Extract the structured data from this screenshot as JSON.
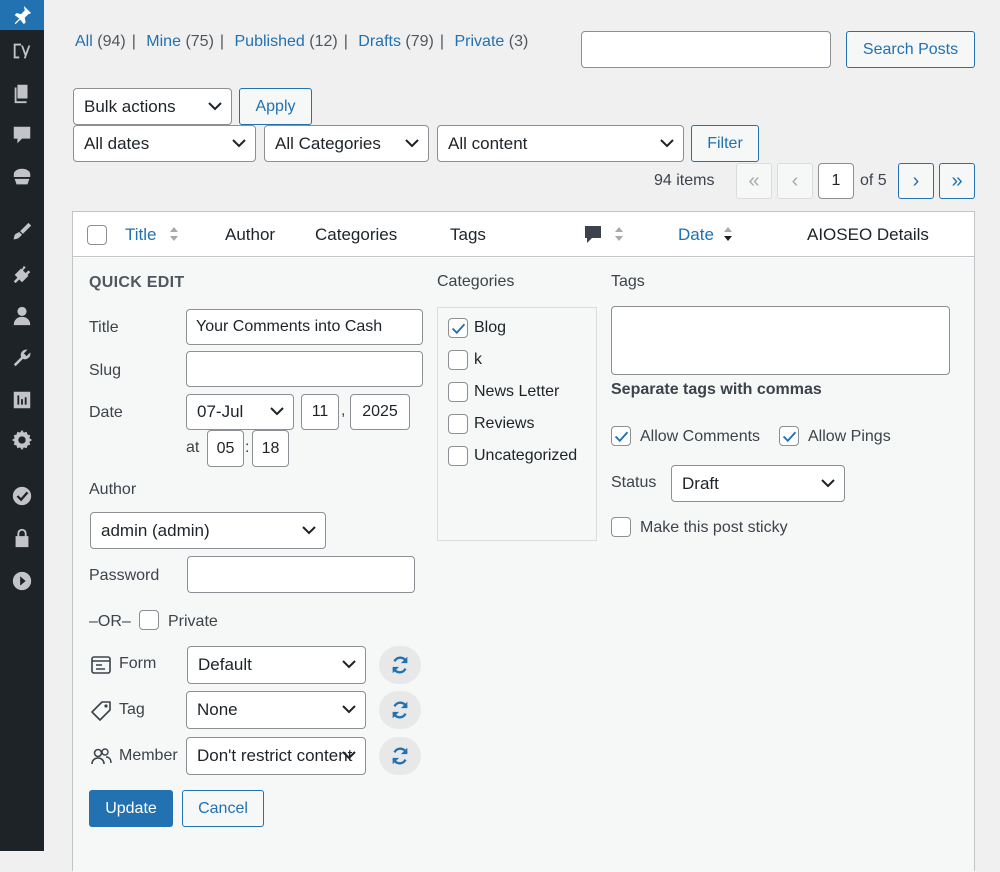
{
  "sidebar": {
    "icons": [
      "pin-icon",
      "yoast-icon",
      "pages-icon",
      "comments-icon",
      "astra-icon",
      "appearance-icon",
      "plugins-icon",
      "users-icon",
      "tools-icon",
      "settings-icon",
      "gear-icon",
      "wordfence-icon",
      "lock-icon",
      "video-icon"
    ]
  },
  "filters": {
    "all_label": "All",
    "all_count": "(94)",
    "mine_label": "Mine",
    "mine_count": "(75)",
    "published_label": "Published",
    "published_count": "(12)",
    "drafts_label": "Drafts",
    "drafts_count": "(79)",
    "private_label": "Private",
    "private_count": "(3)",
    "separator": "|"
  },
  "search": {
    "value": "",
    "button": "Search Posts"
  },
  "bulk": {
    "selected": "Bulk actions",
    "apply": "Apply"
  },
  "dates": {
    "selected": "All dates"
  },
  "categories_filter": {
    "selected": "All Categories"
  },
  "content_filter": {
    "selected": "All content"
  },
  "filter_button": "Filter",
  "pagination": {
    "items": "94 items",
    "first": "«",
    "prev": "‹",
    "current": "1",
    "of": "of 5",
    "next": "›",
    "last": "»"
  },
  "columns": {
    "title": "Title",
    "author": "Author",
    "categories": "Categories",
    "tags": "Tags",
    "date": "Date",
    "aioseo": "AIOSEO Details"
  },
  "quick_edit": {
    "heading": "QUICK EDIT",
    "title_label": "Title",
    "title_value": "Your Comments into Cash",
    "slug_label": "Slug",
    "slug_value": "",
    "date_label": "Date",
    "month": "07-Jul",
    "day": "11",
    "comma": ",",
    "year": "2025",
    "at": "at",
    "hour": "05",
    "colon": ":",
    "minute": "18",
    "author_label": "Author",
    "author_value": "admin (admin)",
    "password_label": "Password",
    "password_value": "",
    "or_label": "–OR–",
    "private_label": "Private",
    "form_label": "Form",
    "form_value": "Default",
    "tag_label": "Tag",
    "tag_value": "None",
    "member_label": "Member",
    "member_value": "Don't restrict content",
    "update": "Update",
    "cancel": "Cancel"
  },
  "categories_box": {
    "heading": "Categories",
    "items": [
      {
        "label": "Blog",
        "checked": true
      },
      {
        "label": "k",
        "checked": false
      },
      {
        "label": "News Letter",
        "checked": false
      },
      {
        "label": "Reviews",
        "checked": false
      },
      {
        "label": "Uncategorized",
        "checked": false
      }
    ]
  },
  "tags_box": {
    "heading": "Tags",
    "value": "",
    "hint": "Separate tags with commas",
    "allow_comments": "Allow Comments",
    "allow_pings": "Allow Pings",
    "status_label": "Status",
    "status_value": "Draft",
    "sticky": "Make this post sticky"
  },
  "colors": {
    "accent": "#2271b1",
    "sidebar": "#1d2327"
  }
}
